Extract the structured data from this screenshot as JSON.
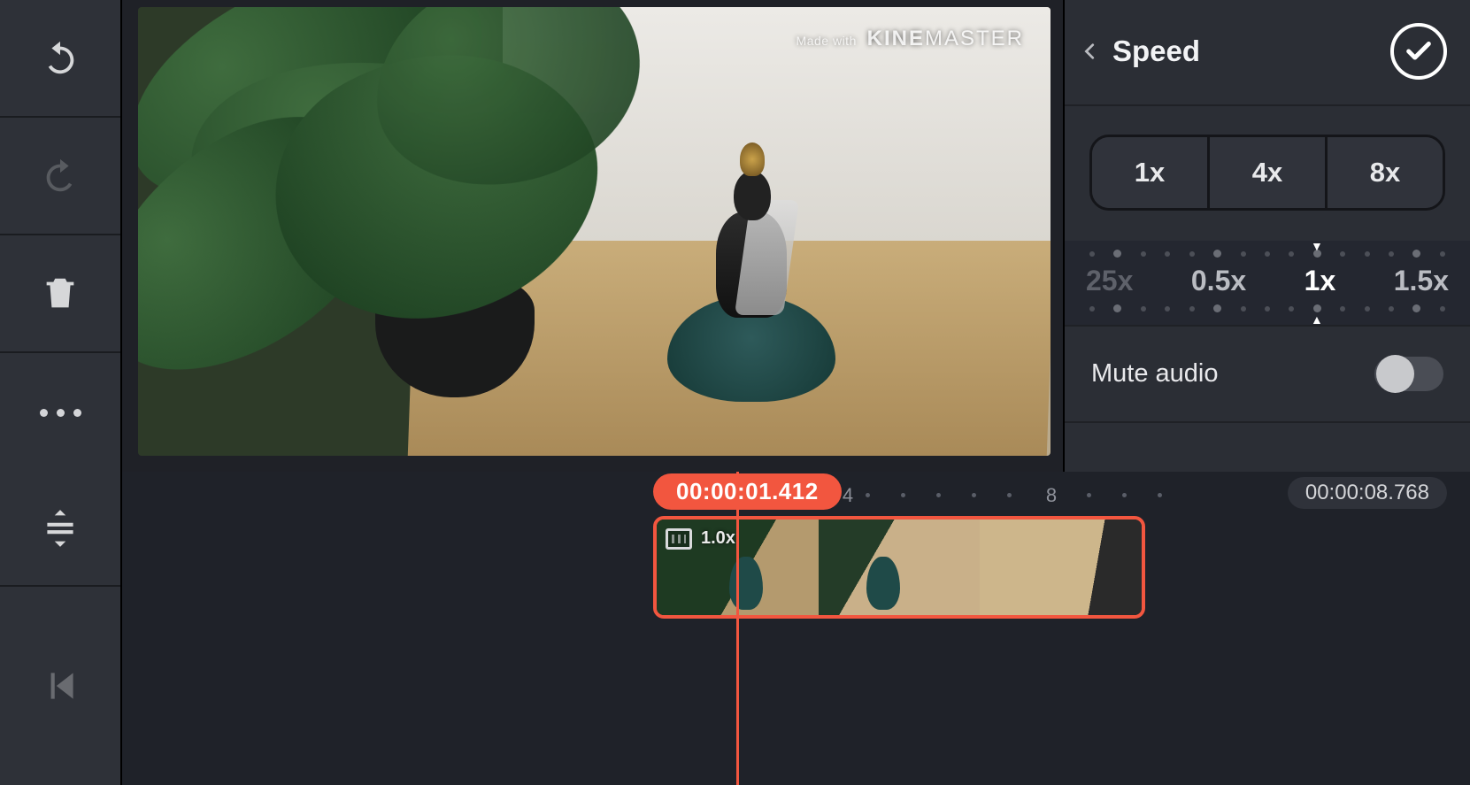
{
  "watermark": {
    "prefix": "Made with",
    "brand_bold": "KINE",
    "brand_light": "MASTER"
  },
  "panel": {
    "title": "Speed",
    "presets": [
      "1x",
      "4x",
      "8x"
    ],
    "dial": {
      "left_dim": "25x",
      "labels": [
        "0.5x",
        "1x",
        "1.5x"
      ],
      "selected": "1x"
    },
    "mute_label": "Mute audio"
  },
  "timeline": {
    "current_time": "00:00:01.412",
    "total_time": "00:00:08.768",
    "ruler_marks": [
      "4",
      "8"
    ],
    "clip_speed_label": "1.0x"
  }
}
